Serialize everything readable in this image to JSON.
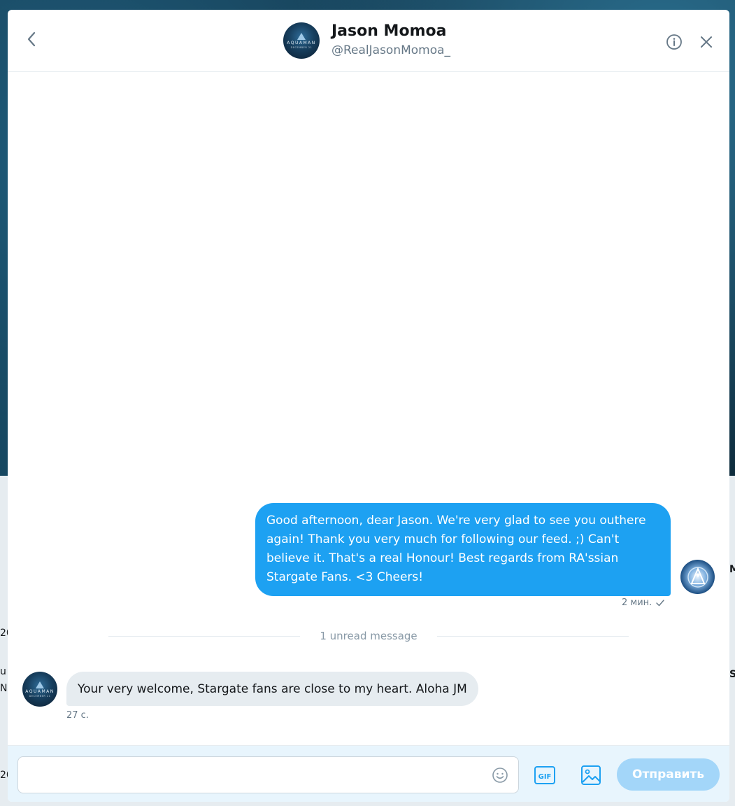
{
  "conversation": {
    "name": "Jason Momoa",
    "handle": "@RealJasonMomoa_"
  },
  "avatar_logo": {
    "word": "AQUAMAN",
    "sub": "DECEMBER 21"
  },
  "messages": [
    {
      "direction": "outgoing",
      "text": "Good afternoon, dear Jason. We're very glad to see you outhere again! Thank you very much for following our feed. ;) Can't believe it. That's a real Honour! Best regards from RA'ssian Stargate Fans. <3 Cheers!",
      "time": "2 мин.",
      "status_icon": "check-icon"
    },
    {
      "direction": "incoming",
      "text": "Your very welcome, Stargate fans are close to my heart. Aloha JM",
      "time": "27 с."
    }
  ],
  "unread_divider": "1 unread message",
  "composer": {
    "placeholder": "",
    "gif_label": "GIF",
    "send_label": "Отправить"
  },
  "colors": {
    "accent": "#1da1f2",
    "accent_disabled": "#a3d6f9",
    "incoming_bubble": "#e6ecf0",
    "muted_text": "#657786"
  },
  "background_peek": [
    "20",
    "u",
    "N",
    "20",
    "M",
    "S"
  ]
}
